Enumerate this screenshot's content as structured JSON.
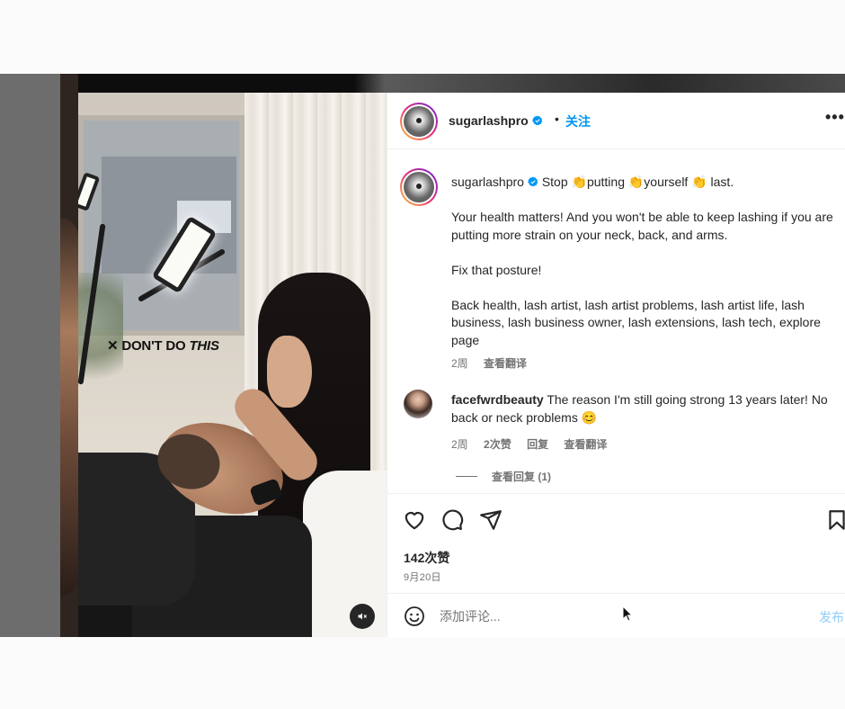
{
  "post": {
    "username": "sugarlashpro",
    "dot": "•",
    "follow_label": "关注",
    "more_label": "•••"
  },
  "video": {
    "overlay_caption_prefix": "✕ DON'T DO ",
    "overlay_caption_emphasis": "THIS"
  },
  "caption": {
    "username": "sugarlashpro",
    "line1": " Stop 👏putting 👏yourself 👏 last.",
    "para1": "Your health matters! And you won't be able to keep lashing if you are putting more strain on your neck, back, and arms.",
    "para2": "Fix that posture!",
    "para3": "Back health, lash artist, lash artist problems, lash artist life, lash business, lash business owner, lash extensions, lash tech, explore page",
    "time": "2周",
    "translate": "查看翻译"
  },
  "comment": {
    "username": "facefwrdbeauty",
    "text": " The reason I'm still going strong 13 years later! No back or neck problems 😊",
    "time": "2周",
    "likes": "2次赞",
    "reply": "回复",
    "translate": "查看翻译",
    "view_replies": "查看回复 (1)"
  },
  "actions": {
    "likes": "142次赞",
    "date": "9月20日"
  },
  "comment_bar": {
    "placeholder": "添加评论...",
    "post_label": "发布"
  },
  "colors": {
    "accent": "#0095f6",
    "post_disabled": "#8ecdf7",
    "text": "#262626",
    "secondary": "#737373"
  },
  "icons": [
    "verified-badge-icon",
    "more-icon",
    "heart-icon",
    "comment-icon",
    "share-icon",
    "bookmark-icon",
    "emoji-icon",
    "mute-icon",
    "cursor-icon"
  ]
}
